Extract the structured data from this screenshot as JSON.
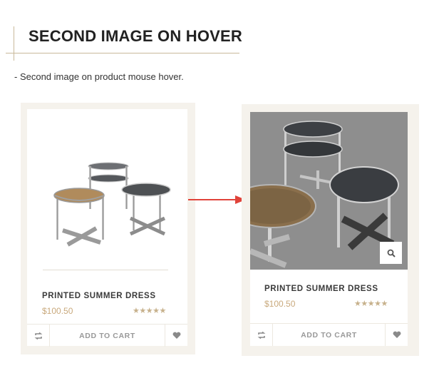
{
  "header": {
    "title": "SECOND IMAGE ON HOVER",
    "description": "- Second image on product mouse hover."
  },
  "cards": [
    {
      "name": "PRINTED SUMMER DRESS",
      "price": "$100.50",
      "rating": 5,
      "stars": "★★★★★",
      "cta": "ADD TO CART",
      "state": "default",
      "icons": [
        "compare-icon",
        "heart-icon"
      ]
    },
    {
      "name": "PRINTED SUMMER DRESS",
      "price": "$100.50",
      "rating": 5,
      "stars": "★★★★★",
      "cta": "ADD TO CART",
      "state": "hover",
      "icons": [
        "compare-icon",
        "heart-icon",
        "search-icon"
      ]
    }
  ],
  "colors": {
    "accent": "#c9a97c",
    "arrow": "#e0433a",
    "card_bg": "#f5f2ec"
  }
}
